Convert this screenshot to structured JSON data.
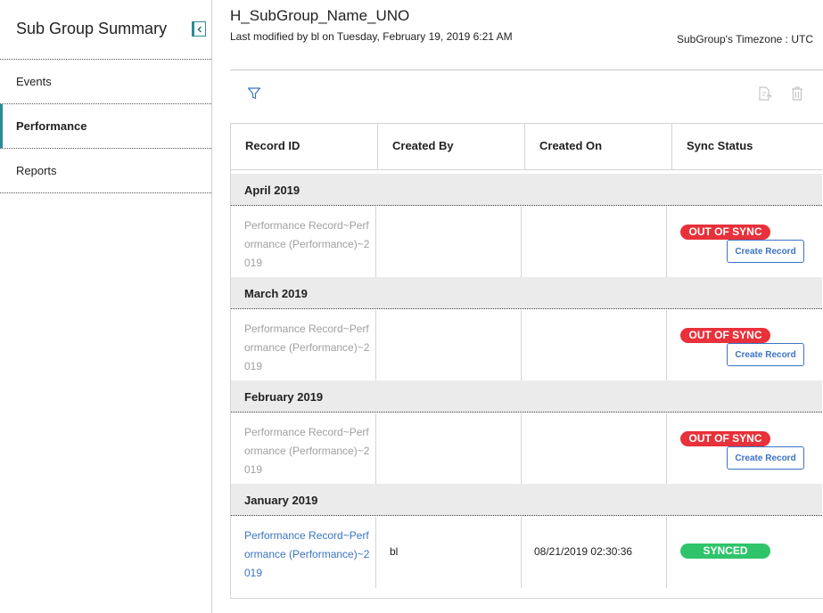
{
  "sidebar": {
    "title": "Sub Group Summary",
    "items": [
      {
        "label": "Events"
      },
      {
        "label": "Performance"
      },
      {
        "label": "Reports"
      }
    ]
  },
  "header": {
    "title": "H_SubGroup_Name_UNO",
    "last_modified": "Last modified by bl on Tuesday, February 19, 2019 6:21 AM",
    "timezone": "SubGroup's Timezone : UTC"
  },
  "table": {
    "columns": [
      "Record ID",
      "Created By",
      "Created On",
      "Sync Status"
    ],
    "groups": [
      {
        "label": "April 2019",
        "record_id": "Performance Record~Performance (Performance)~2019",
        "created_by": "",
        "created_on": "",
        "status": "OUT OF SYNC",
        "action": "Create Record"
      },
      {
        "label": "March 2019",
        "record_id": "Performance Record~Performance (Performance)~2019",
        "created_by": "",
        "created_on": "",
        "status": "OUT OF SYNC",
        "action": "Create Record"
      },
      {
        "label": "February 2019",
        "record_id": "Performance Record~Performance (Performance)~2019",
        "created_by": "",
        "created_on": "",
        "status": "OUT OF SYNC",
        "action": "Create Record"
      },
      {
        "label": "January 2019",
        "record_id": "Performance Record~Performance (Performance)~2019",
        "created_by": "bl",
        "created_on": "08/21/2019 02:30:36",
        "status": "SYNCED"
      }
    ]
  },
  "colors": {
    "accent": "#2a8a9a",
    "link": "#3b73c4",
    "out_of_sync": "#e8313a",
    "synced": "#2fc46a"
  },
  "icons": [
    "collapse-left-icon",
    "filter-icon",
    "export-icon",
    "trash-icon"
  ]
}
